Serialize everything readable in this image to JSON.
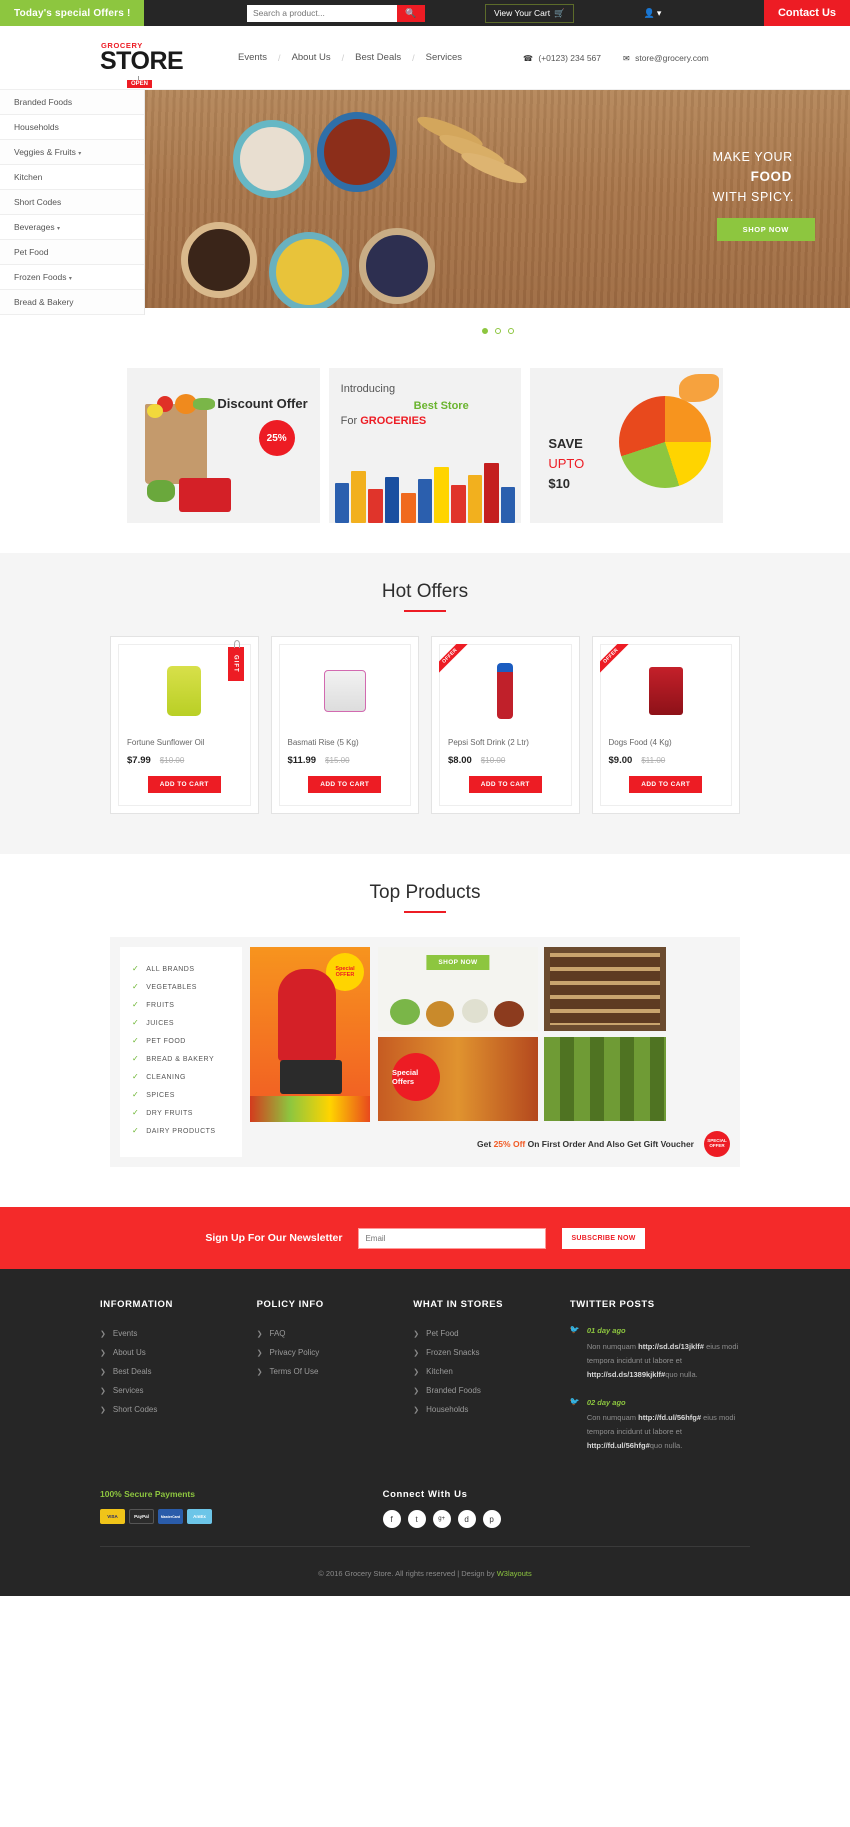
{
  "topbar": {
    "offers": "Today's special Offers !",
    "search_placeholder": "Search a product...",
    "search_icon": "search-icon",
    "cart_label": "View Your Cart",
    "cart_icon": "cart-icon",
    "user_icon": "user-icon",
    "user_caret": "▾",
    "contact": "Contact Us"
  },
  "header": {
    "logo_top": "GROCERY",
    "logo_main": "STORE",
    "logo_badge": "OPEN",
    "nav": [
      "Events",
      "About Us",
      "Best Deals",
      "Services"
    ],
    "separator": "/",
    "phone": "(+0123) 234 567",
    "phone_icon": "phone-icon",
    "email": "store@grocery.com",
    "email_icon": "envelope-icon"
  },
  "sidebar": {
    "items": [
      {
        "label": "Branded Foods",
        "caret": false
      },
      {
        "label": "Households",
        "caret": false
      },
      {
        "label": "Veggies & Fruits",
        "caret": true
      },
      {
        "label": "Kitchen",
        "caret": false
      },
      {
        "label": "Short Codes",
        "caret": false
      },
      {
        "label": "Beverages",
        "caret": true
      },
      {
        "label": "Pet Food",
        "caret": false
      },
      {
        "label": "Frozen Foods",
        "caret": true
      },
      {
        "label": "Bread & Bakery",
        "caret": false
      }
    ]
  },
  "hero": {
    "line1": "MAKE YOUR",
    "line2": "FOOD",
    "line3": "WITH SPICY.",
    "button": "SHOP NOW",
    "dots": 3,
    "active_dot": 0
  },
  "promos": {
    "card1": {
      "title": "Discount Offer",
      "badge": "25%"
    },
    "card2": {
      "intro": "Introducing",
      "best": "Best Store",
      "for": "For ",
      "groceries": "GROCERIES"
    },
    "card3": {
      "save": "SAVE",
      "upto": "UPTO",
      "amount": "$10"
    }
  },
  "hot_offers": {
    "heading": "Hot Offers",
    "products": [
      {
        "name": "Fortune Sunflower Oil",
        "price": "$7.99",
        "old_price": "$10.00",
        "button": "ADD TO CART",
        "ribbon": "GIFT",
        "ribbon_type": "tag"
      },
      {
        "name": "Basmati Rise (5 Kg)",
        "price": "$11.99",
        "old_price": "$15.00",
        "button": "ADD TO CART",
        "ribbon": "",
        "ribbon_type": "none"
      },
      {
        "name": "Pepsi Soft Drink (2 Ltr)",
        "price": "$8.00",
        "old_price": "$10.00",
        "button": "ADD TO CART",
        "ribbon": "OFFER",
        "ribbon_type": "corner"
      },
      {
        "name": "Dogs Food (4 Kg)",
        "price": "$9.00",
        "old_price": "$11.00",
        "button": "ADD TO CART",
        "ribbon": "OFFER",
        "ribbon_type": "corner"
      }
    ]
  },
  "top_products": {
    "heading": "Top Products",
    "categories": [
      "ALL BRANDS",
      "VEGETABLES",
      "FRUITS",
      "JUICES",
      "PET FOOD",
      "BREAD & BAKERY",
      "CLEANING",
      "SPICES",
      "DRY FRUITS",
      "DAIRY PRODUCTS"
    ],
    "check_icon": "check-icon",
    "special_offer_badge": "Special OFFER",
    "shop_now": "SHOP NOW",
    "special_offers_circle": "Special Offers",
    "footer_text_1": "Get ",
    "footer_percent": "25% Off",
    "footer_text_2": " On First Order And Also Get Gift Voucher",
    "seal": "SPECIAL OFFER"
  },
  "newsletter": {
    "label": "Sign Up For Our Newsletter",
    "placeholder": "Email",
    "button": "SUBSCRIBE NOW"
  },
  "footer": {
    "columns": [
      {
        "heading": "INFORMATION",
        "links": [
          "Events",
          "About Us",
          "Best Deals",
          "Services",
          "Short Codes"
        ]
      },
      {
        "heading": "POLICY INFO",
        "links": [
          "FAQ",
          "Privacy Policy",
          "Terms Of Use"
        ]
      },
      {
        "heading": "WHAT IN STORES",
        "links": [
          "Pet Food",
          "Frozen Snacks",
          "Kitchen",
          "Branded Foods",
          "Households"
        ]
      }
    ],
    "arrow_icon": "chevron-right-icon",
    "twitter": {
      "heading": "TWITTER POSTS",
      "icon": "twitter-icon",
      "posts": [
        {
          "time": "01 day ago",
          "text_1": "Non numquam ",
          "link_1": "http://sd.ds/13jklf#",
          "text_2": " eius modi tempora incidunt ut labore et ",
          "link_2": "http://sd.ds/1389kjklf#",
          "text_3": "quo nulla."
        },
        {
          "time": "02 day ago",
          "text_1": "Con numquam ",
          "link_1": "http://fd.ul/56hfg#",
          "text_2": " eius modi tempora incidunt ut labore et ",
          "link_2": "http://fd.ul/56hfg#",
          "text_3": "quo nulla."
        }
      ]
    },
    "payments_heading": "100% Secure Payments",
    "cards": [
      {
        "label": "VISA",
        "color": "#1a1f71",
        "bg": "#f0c419"
      },
      {
        "label": "PayPal",
        "color": "#ffffff",
        "bg": "#2b2b2b"
      },
      {
        "label": "MasterCard",
        "color": "#ffffff",
        "bg": "#2a5caa"
      },
      {
        "label": "AmEx",
        "color": "#ffffff",
        "bg": "#6cc5e8"
      }
    ],
    "connect_heading": "Connect With Us",
    "social": [
      "facebook-icon",
      "twitter-icon",
      "google-plus-icon",
      "dribbble-icon",
      "pinterest-icon"
    ],
    "social_glyphs": [
      "f",
      "t",
      "g+",
      "d",
      "p"
    ],
    "copyright_1": "© 2016 Grocery Store. All rights reserved | Design by ",
    "copyright_link": "W3layouts"
  },
  "colors": {
    "red": "#ed1c24",
    "green": "#8dc63f",
    "dark": "#262626"
  }
}
